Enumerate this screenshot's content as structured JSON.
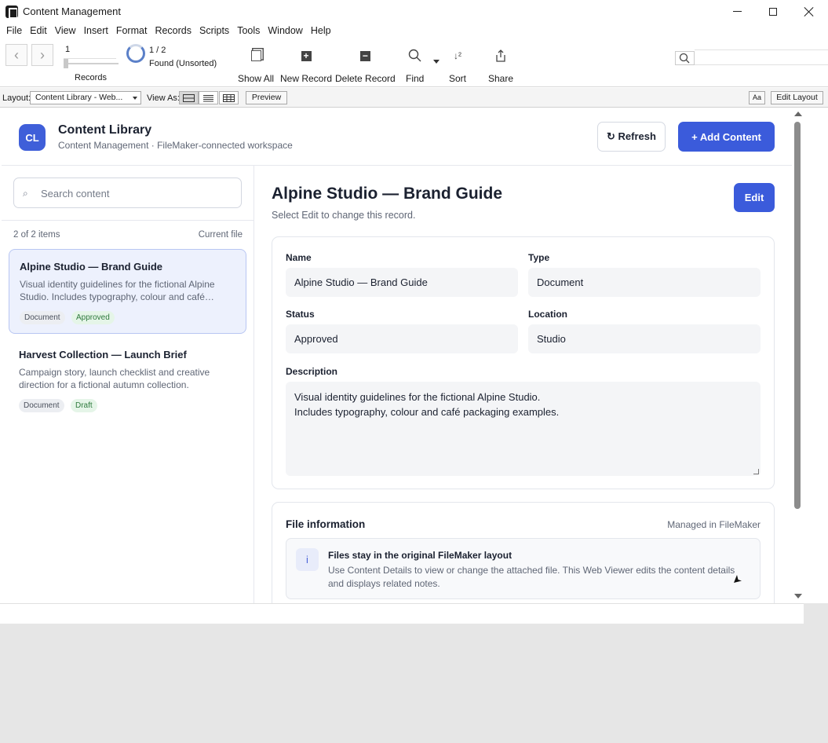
{
  "window": {
    "title": "Content Management"
  },
  "menu": [
    "File",
    "Edit",
    "View",
    "Insert",
    "Format",
    "Records",
    "Scripts",
    "Tools",
    "Window",
    "Help"
  ],
  "toolbar": {
    "record_number": "1",
    "records_label": "Records",
    "found_count": "1 / 2",
    "found_status": "Found (Unsorted)",
    "buttons": {
      "show_all": "Show All",
      "new_record": "New Record",
      "delete_record": "Delete Record",
      "find": "Find",
      "sort": "Sort",
      "share": "Share"
    }
  },
  "layout_bar": {
    "layout_label": "Layout:",
    "layout_value": "Content Library - Web...",
    "view_as_label": "View As:",
    "preview": "Preview",
    "font_size_btn": "Aa",
    "edit_layout": "Edit Layout"
  },
  "app": {
    "badge": "CL",
    "title": "Content Library",
    "subtitle": "Content Management · FileMaker-connected workspace",
    "refresh": "↻ Refresh",
    "add_content": "+ Add Content"
  },
  "sidebar": {
    "search_placeholder": "Search content",
    "items_count": "2 of 2 items",
    "current_file": "Current file",
    "items": [
      {
        "title": "Alpine Studio — Brand Guide",
        "desc": "Visual identity guidelines for the fictional Alpine Studio. Includes typography, colour and café…",
        "type": "Document",
        "status": "Approved"
      },
      {
        "title": "Harvest Collection — Launch Brief",
        "desc": "Campaign story, launch checklist and creative direction for a fictional autumn collection.",
        "type": "Document",
        "status": "Draft"
      }
    ]
  },
  "record": {
    "title": "Alpine Studio — Brand Guide",
    "hint": "Select Edit to change this record.",
    "edit": "Edit",
    "fields": {
      "name_label": "Name",
      "name_value": "Alpine Studio — Brand Guide",
      "type_label": "Type",
      "type_value": "Document",
      "status_label": "Status",
      "status_value": "Approved",
      "location_label": "Location",
      "location_value": "Studio",
      "description_label": "Description",
      "description_line1": "Visual identity guidelines for the fictional Alpine Studio.",
      "description_line2": "Includes typography, colour and café packaging examples."
    },
    "file_info": {
      "title": "File information",
      "managed": "Managed in FileMaker",
      "info_icon": "i",
      "notice_title": "Files stay in the original FileMaker layout",
      "notice_text": "Use Content Details to view or change the attached file. This Web Viewer edits the content details and displays related notes."
    }
  },
  "colors": {
    "accent": "#3b5bdb",
    "selected_bg": "#edf1fd",
    "approved": "#2e7a3d"
  }
}
